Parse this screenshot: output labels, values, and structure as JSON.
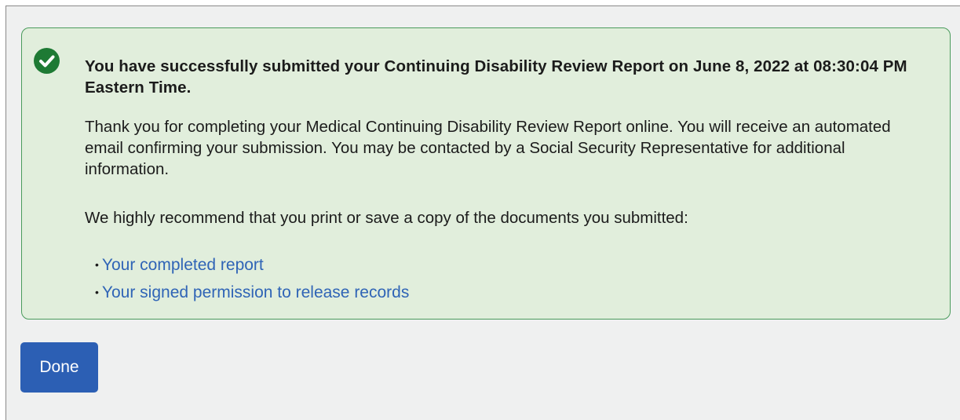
{
  "alert": {
    "heading": "You have successfully submitted your Continuing Disability Review Report on June 8, 2022 at 08:30:04 PM Eastern Time.",
    "body": "Thank you for completing your Medical Continuing Disability Review Report online. You will receive an automated email confirming your submission. You may be contacted by a Social Security Representative for additional information.",
    "recommendation": "We highly recommend that you print or save a copy of the documents you submitted:",
    "documents": [
      {
        "label": "Your completed report"
      },
      {
        "label": "Your signed permission to release records"
      }
    ],
    "icon": "check-circle-icon",
    "colors": {
      "background": "#e1eedc",
      "border": "#4a9b5c",
      "icon": "#1e7a34",
      "link": "#2f64b6"
    }
  },
  "actions": {
    "done_label": "Done",
    "button_color": "#2c5fb4"
  }
}
